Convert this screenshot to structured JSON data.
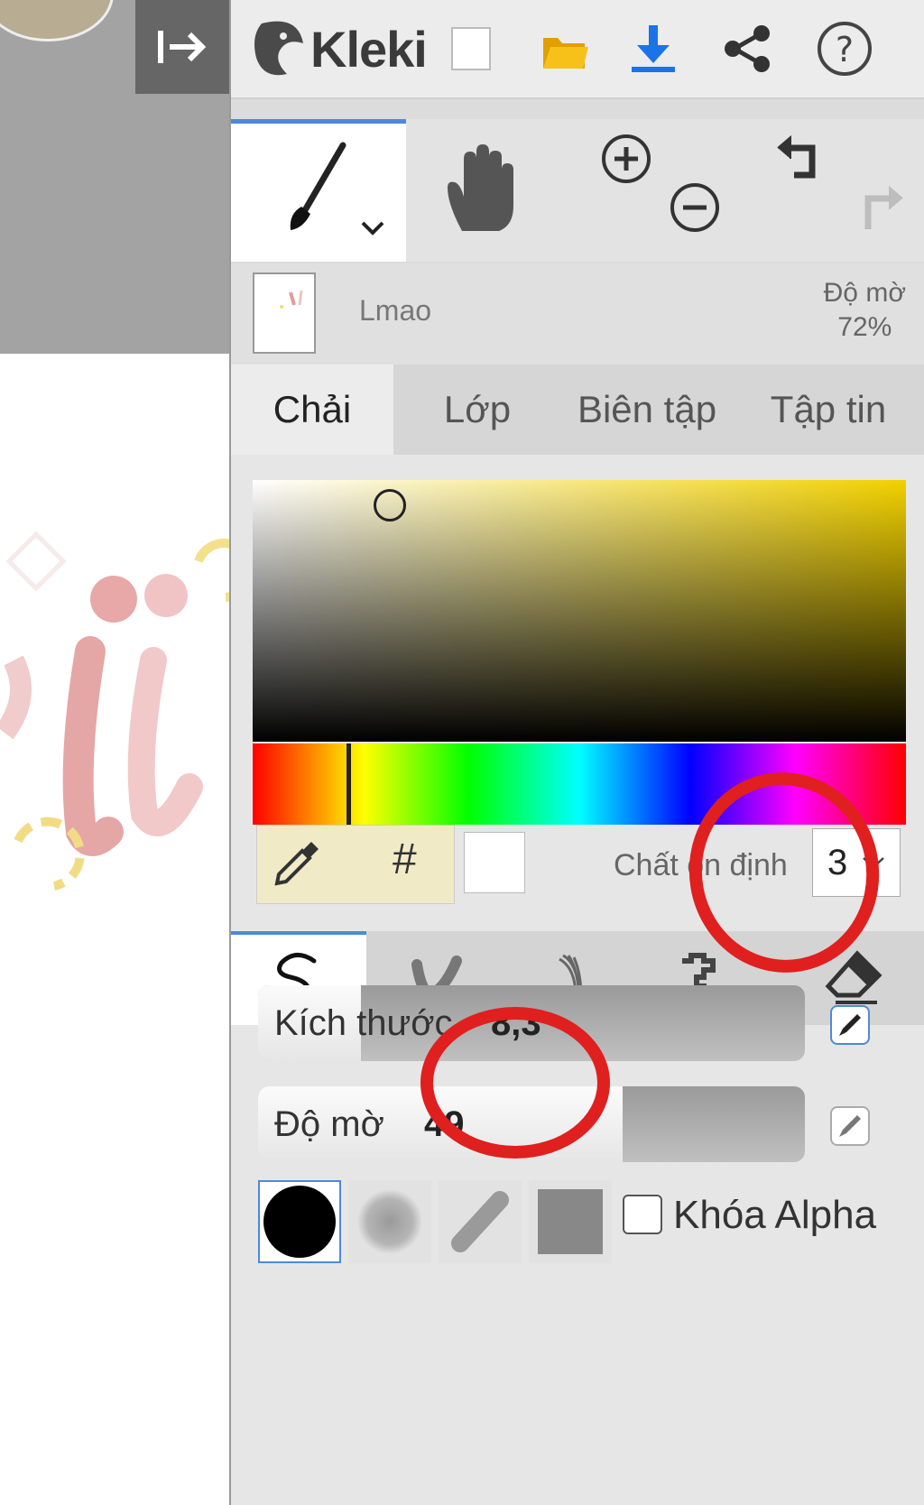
{
  "app": {
    "name": "Kleki"
  },
  "toolbar": {
    "icons": [
      "new-image-icon",
      "open-folder-icon",
      "download-icon",
      "share-icon",
      "help-icon"
    ]
  },
  "tools": {
    "active": "brush",
    "items": [
      "brush-icon",
      "hand-icon",
      "zoom-in-icon",
      "zoom-out-icon",
      "undo-icon",
      "redo-icon"
    ]
  },
  "layer": {
    "name": "Lmao",
    "opacity_label": "Độ mờ",
    "opacity_value": "72%"
  },
  "tabs": [
    {
      "label": "Chải",
      "active": true
    },
    {
      "label": "Lớp",
      "active": false
    },
    {
      "label": "Biên tập",
      "active": false
    },
    {
      "label": "Tập tin",
      "active": false
    }
  ],
  "color": {
    "hex_button": "#",
    "selected_color": "#ffffff",
    "hue_color": "#f2d100"
  },
  "stabilizer": {
    "label": "Chất ổn định",
    "value": "3"
  },
  "brush_types": [
    "pen-brush",
    "blend-brush",
    "sketchy-brush",
    "pixel-brush",
    "eraser"
  ],
  "sliders": {
    "size": {
      "label": "Kích thước",
      "value": "8,3"
    },
    "opacity": {
      "label": "Độ mờ",
      "value": "49"
    }
  },
  "shapes": [
    "round-hard",
    "round-soft",
    "chisel",
    "square"
  ],
  "alpha_lock": {
    "label": "Khóa Alpha",
    "checked": false
  },
  "colors": {
    "accent": "#4d8ad6",
    "annotation": "#e01f1f"
  }
}
